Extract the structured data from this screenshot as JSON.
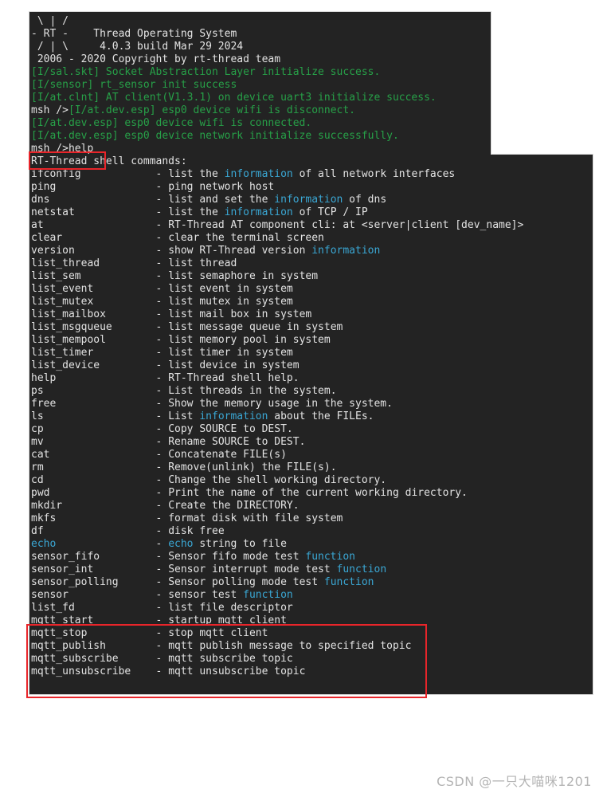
{
  "colors": {
    "terminal_background": "#232323",
    "page_background": "#ffffff",
    "default_text": "#d6d6d6",
    "log_green": "#27a048",
    "keyword_blue": "#3aa7d4",
    "annotation_red": "#e8252a",
    "watermark_gray": "#b4b4b4"
  },
  "terminal": {
    "banner": [
      {
        "art": " \\ | /",
        "text": ""
      },
      {
        "art": "- RT -",
        "text": "    Thread Operating System"
      },
      {
        "art": " / | \\",
        "text": "     4.0.3 build Mar 29 2024"
      }
    ],
    "copyright": " 2006 - 2020 Copyright by rt-thread team",
    "boot_log": [
      {
        "tag": "[I/sal.skt]",
        "message": " Socket Abstraction Layer initialize success.",
        "prompt_prefix": ""
      },
      {
        "tag": "[I/sensor]",
        "message": " rt_sensor init success",
        "prompt_prefix": ""
      },
      {
        "tag": "[I/at.clnt]",
        "message": " AT client(V1.3.1) on device uart3 initialize success.",
        "prompt_prefix": ""
      },
      {
        "tag": "[I/at.dev.esp]",
        "message": " esp0 device wifi is disconnect.",
        "prompt_prefix": "msh />"
      },
      {
        "tag": "[I/at.dev.esp]",
        "message": " esp0 device wifi is connected.",
        "prompt_prefix": ""
      },
      {
        "tag": "[I/at.dev.esp]",
        "message": " esp0 device network initialize successfully.",
        "prompt_prefix": ""
      }
    ],
    "prompt": "msh />",
    "typed_command": "help",
    "help_header": "RT-Thread shell commands:",
    "commands": [
      {
        "name": "ifconfig",
        "name_blue": false,
        "desc": "list the ",
        "desc_blue": "information",
        "desc_tail": " of all network interfaces"
      },
      {
        "name": "ping",
        "name_blue": false,
        "desc": "ping network host",
        "desc_blue": "",
        "desc_tail": ""
      },
      {
        "name": "dns",
        "name_blue": false,
        "desc": "list and set the ",
        "desc_blue": "information",
        "desc_tail": " of dns"
      },
      {
        "name": "netstat",
        "name_blue": false,
        "desc": "list the ",
        "desc_blue": "information",
        "desc_tail": " of TCP / IP"
      },
      {
        "name": "at",
        "name_blue": false,
        "desc": "RT-Thread AT component cli: at <server|client [dev_name]>",
        "desc_blue": "",
        "desc_tail": ""
      },
      {
        "name": "clear",
        "name_blue": false,
        "desc": "clear the terminal screen",
        "desc_blue": "",
        "desc_tail": ""
      },
      {
        "name": "version",
        "name_blue": false,
        "desc": "show RT-Thread version ",
        "desc_blue": "information",
        "desc_tail": ""
      },
      {
        "name": "list_thread",
        "name_blue": false,
        "desc": "list thread",
        "desc_blue": "",
        "desc_tail": ""
      },
      {
        "name": "list_sem",
        "name_blue": false,
        "desc": "list semaphore in system",
        "desc_blue": "",
        "desc_tail": ""
      },
      {
        "name": "list_event",
        "name_blue": false,
        "desc": "list event in system",
        "desc_blue": "",
        "desc_tail": ""
      },
      {
        "name": "list_mutex",
        "name_blue": false,
        "desc": "list mutex in system",
        "desc_blue": "",
        "desc_tail": ""
      },
      {
        "name": "list_mailbox",
        "name_blue": false,
        "desc": "list mail box in system",
        "desc_blue": "",
        "desc_tail": ""
      },
      {
        "name": "list_msgqueue",
        "name_blue": false,
        "desc": "list message queue in system",
        "desc_blue": "",
        "desc_tail": ""
      },
      {
        "name": "list_mempool",
        "name_blue": false,
        "desc": "list memory pool in system",
        "desc_blue": "",
        "desc_tail": ""
      },
      {
        "name": "list_timer",
        "name_blue": false,
        "desc": "list timer in system",
        "desc_blue": "",
        "desc_tail": ""
      },
      {
        "name": "list_device",
        "name_blue": false,
        "desc": "list device in system",
        "desc_blue": "",
        "desc_tail": ""
      },
      {
        "name": "help",
        "name_blue": false,
        "desc": "RT-Thread shell help.",
        "desc_blue": "",
        "desc_tail": ""
      },
      {
        "name": "ps",
        "name_blue": false,
        "desc": "List threads in the system.",
        "desc_blue": "",
        "desc_tail": ""
      },
      {
        "name": "free",
        "name_blue": false,
        "desc": "Show the memory usage in the system.",
        "desc_blue": "",
        "desc_tail": ""
      },
      {
        "name": "ls",
        "name_blue": false,
        "desc": "List ",
        "desc_blue": "information",
        "desc_tail": " about the FILEs."
      },
      {
        "name": "cp",
        "name_blue": false,
        "desc": "Copy SOURCE to DEST.",
        "desc_blue": "",
        "desc_tail": ""
      },
      {
        "name": "mv",
        "name_blue": false,
        "desc": "Rename SOURCE to DEST.",
        "desc_blue": "",
        "desc_tail": ""
      },
      {
        "name": "cat",
        "name_blue": false,
        "desc": "Concatenate FILE(s)",
        "desc_blue": "",
        "desc_tail": ""
      },
      {
        "name": "rm",
        "name_blue": false,
        "desc": "Remove(unlink) the FILE(s).",
        "desc_blue": "",
        "desc_tail": ""
      },
      {
        "name": "cd",
        "name_blue": false,
        "desc": "Change the shell working directory.",
        "desc_blue": "",
        "desc_tail": ""
      },
      {
        "name": "pwd",
        "name_blue": false,
        "desc": "Print the name of the current working directory.",
        "desc_blue": "",
        "desc_tail": ""
      },
      {
        "name": "mkdir",
        "name_blue": false,
        "desc": "Create the DIRECTORY.",
        "desc_blue": "",
        "desc_tail": ""
      },
      {
        "name": "mkfs",
        "name_blue": false,
        "desc": "format disk with file system",
        "desc_blue": "",
        "desc_tail": ""
      },
      {
        "name": "df",
        "name_blue": false,
        "desc": "disk free",
        "desc_blue": "",
        "desc_tail": ""
      },
      {
        "name": "echo",
        "name_blue": true,
        "desc": "",
        "desc_blue": "echo",
        "desc_tail": " string to file"
      },
      {
        "name": "sensor_fifo",
        "name_blue": false,
        "desc": "Sensor fifo mode test ",
        "desc_blue": "function",
        "desc_tail": ""
      },
      {
        "name": "sensor_int",
        "name_blue": false,
        "desc": "Sensor interrupt mode test ",
        "desc_blue": "function",
        "desc_tail": ""
      },
      {
        "name": "sensor_polling",
        "name_blue": false,
        "desc": "Sensor polling mode test ",
        "desc_blue": "function",
        "desc_tail": ""
      },
      {
        "name": "sensor",
        "name_blue": false,
        "desc": "sensor test ",
        "desc_blue": "function",
        "desc_tail": ""
      },
      {
        "name": "list_fd",
        "name_blue": false,
        "desc": "list file descriptor",
        "desc_blue": "",
        "desc_tail": ""
      },
      {
        "name": "mqtt_start",
        "name_blue": false,
        "desc": "startup mqtt client",
        "desc_blue": "",
        "desc_tail": ""
      },
      {
        "name": "mqtt_stop",
        "name_blue": false,
        "desc": "stop mqtt client",
        "desc_blue": "",
        "desc_tail": ""
      },
      {
        "name": "mqtt_publish",
        "name_blue": false,
        "desc": "mqtt publish message to specified topic",
        "desc_blue": "",
        "desc_tail": ""
      },
      {
        "name": "mqtt_subscribe",
        "name_blue": false,
        "desc": "mqtt subscribe topic",
        "desc_blue": "",
        "desc_tail": ""
      },
      {
        "name": "mqtt_unsubscribe",
        "name_blue": false,
        "desc": "mqtt unsubscribe topic",
        "desc_blue": "",
        "desc_tail": ""
      }
    ]
  },
  "annotations": [
    {
      "id": "help-command-highlight",
      "target": "msh />help"
    },
    {
      "id": "mqtt-commands-highlight",
      "target": "mqtt commands block"
    }
  ],
  "watermark": "CSDN @一只大喵咪1201"
}
